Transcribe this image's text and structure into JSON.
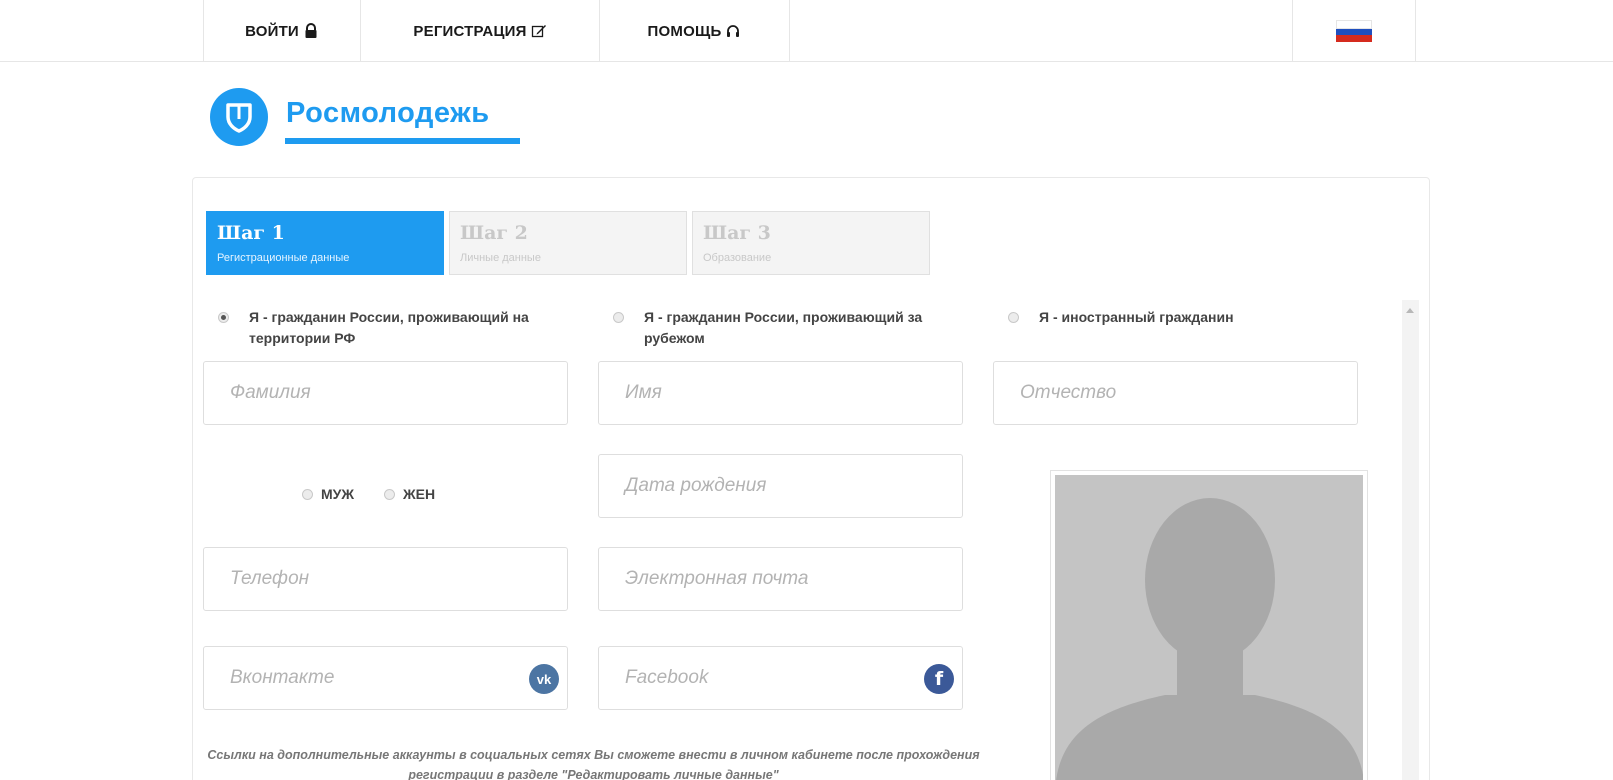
{
  "nav": {
    "login": "ВОЙТИ",
    "register": "РЕГИСТРАЦИЯ",
    "help": "ПОМОЩЬ",
    "flag_colors": [
      "#ffffff",
      "#1f4fbf",
      "#d52b1e"
    ]
  },
  "logo": {
    "text": "Росмолодежь",
    "color": "#1e9bf0"
  },
  "steps": [
    {
      "title": "Шаг 1",
      "subtitle": "Регистрационные данные",
      "active": true
    },
    {
      "title": "Шаг 2",
      "subtitle": "Личные данные",
      "active": false
    },
    {
      "title": "Шаг 3",
      "subtitle": "Образование",
      "active": false
    }
  ],
  "citizenship": [
    {
      "label": "Я - гражданин России, проживающий на территории РФ",
      "checked": true
    },
    {
      "label": "Я - гражданин России, проживающий за рубежом",
      "checked": false
    },
    {
      "label": "Я - иностранный гражданин",
      "checked": false
    }
  ],
  "fields": {
    "last_name": "Фамилия",
    "first_name": "Имя",
    "patronymic": "Отчество",
    "birth_date": "Дата рождения",
    "phone": "Телефон",
    "email": "Электронная почта",
    "vk": "Вконтакте",
    "facebook": "Facebook"
  },
  "gender": {
    "male": "МУЖ",
    "female": "ЖЕН"
  },
  "note": "Ссылки на дополнительные аккаунты в социальных сетях Вы сможете внести в личном кабинете после прохождения регистрации в разделе \"Редактировать личные данные\"",
  "colors": {
    "accent": "#1e9bf0",
    "vk": "#4c75a3",
    "facebook": "#3b5998"
  }
}
